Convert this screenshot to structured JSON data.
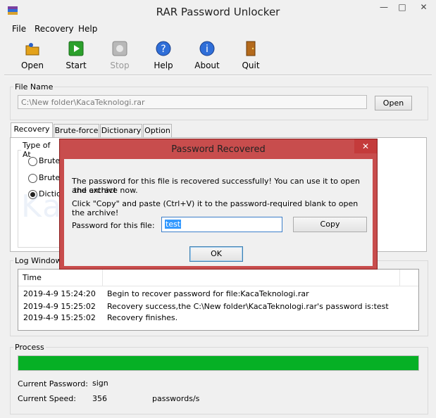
{
  "window": {
    "title": "RAR Password Unlocker"
  },
  "menu": [
    "File",
    "Recovery",
    "Help"
  ],
  "toolbar": {
    "open": "Open",
    "start": "Start",
    "stop": "Stop",
    "help": "Help",
    "about": "About",
    "quit": "Quit"
  },
  "file": {
    "group_label": "File Name",
    "path": "C:\\New folder\\KacaTeknologi.rar",
    "open_button": "Open"
  },
  "tabs": [
    "Recovery",
    "Brute-force",
    "Dictionary",
    "Option"
  ],
  "recovery": {
    "type_label": "Type of At",
    "options": [
      "Brute",
      "Brute",
      "Diction"
    ],
    "selected_index": 2
  },
  "log": {
    "group_label": "Log Window",
    "columns": [
      "Time"
    ],
    "rows": [
      {
        "time": "2019-4-9 15:24:20",
        "message": "Begin to recover password for file:KacaTeknologi.rar"
      },
      {
        "time": "2019-4-9 15:25:02",
        "message": "Recovery success,the C:\\New folder\\KacaTeknologi.rar's password is:test"
      },
      {
        "time": "2019-4-9 15:25:02",
        "message": "Recovery finishes."
      }
    ]
  },
  "process": {
    "group_label": "Process",
    "progress_fraction": 1.0,
    "current_password_label": "Current Password:",
    "current_password": "sign",
    "current_speed_label": "Current Speed:",
    "current_speed": "356",
    "speed_unit": "passwords/s"
  },
  "dialog": {
    "title": "Password Recovered",
    "message_1": "The password for this file is recovered successfully! You can use it to open and extract",
    "message_1b": "the archive now.",
    "message_2": "Click \"Copy\" and paste (Ctrl+V) it to the password-required blank to open the archive!",
    "password_label": "Password for this file:",
    "password_value": "test",
    "copy_button": "Copy",
    "ok_button": "OK"
  },
  "watermark": "KacaTeknologi.com",
  "colors": {
    "progress": "#06b025",
    "dialog_frame": "#c84d4d",
    "selection": "#3399ff"
  }
}
